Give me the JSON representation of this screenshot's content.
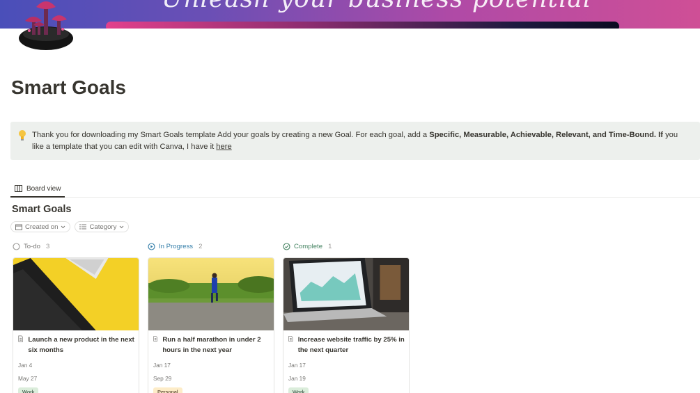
{
  "banner": {
    "text": "Unleash your business potential"
  },
  "page": {
    "title": "Smart Goals"
  },
  "callout": {
    "part1": "Thank you for downloading my Smart Goals template Add your goals by creating a new Goal. For each goal, add a ",
    "bold1": "Specific, Measurable, Achievable,  Relevant, and Time-Bound. If",
    "part2": " you like a template that you can edit with Canva, I have it ",
    "link": "here"
  },
  "view": {
    "tab_label": "Board view"
  },
  "database": {
    "title": "Smart Goals"
  },
  "filters": {
    "created_on": "Created on",
    "category": "Category"
  },
  "columns": [
    {
      "label": "To-do",
      "count": "3",
      "color": "#787774"
    },
    {
      "label": "In Progress",
      "count": "2",
      "color": "#337ea9"
    },
    {
      "label": "Complete",
      "count": "1",
      "color": "#448361"
    }
  ],
  "cards": [
    {
      "title": "Launch a new product in the next six months",
      "date1": "Jan 4",
      "date2": "May 27",
      "tag": "Work"
    },
    {
      "title": "Run a half marathon in under 2 hours in the next year",
      "date1": "Jan 17",
      "date2": "Sep 29",
      "tag": "Personal"
    },
    {
      "title": "Increase website traffic by 25% in the next quarter",
      "date1": "Jan 17",
      "date2": "Jan 19",
      "tag": "Work"
    }
  ]
}
